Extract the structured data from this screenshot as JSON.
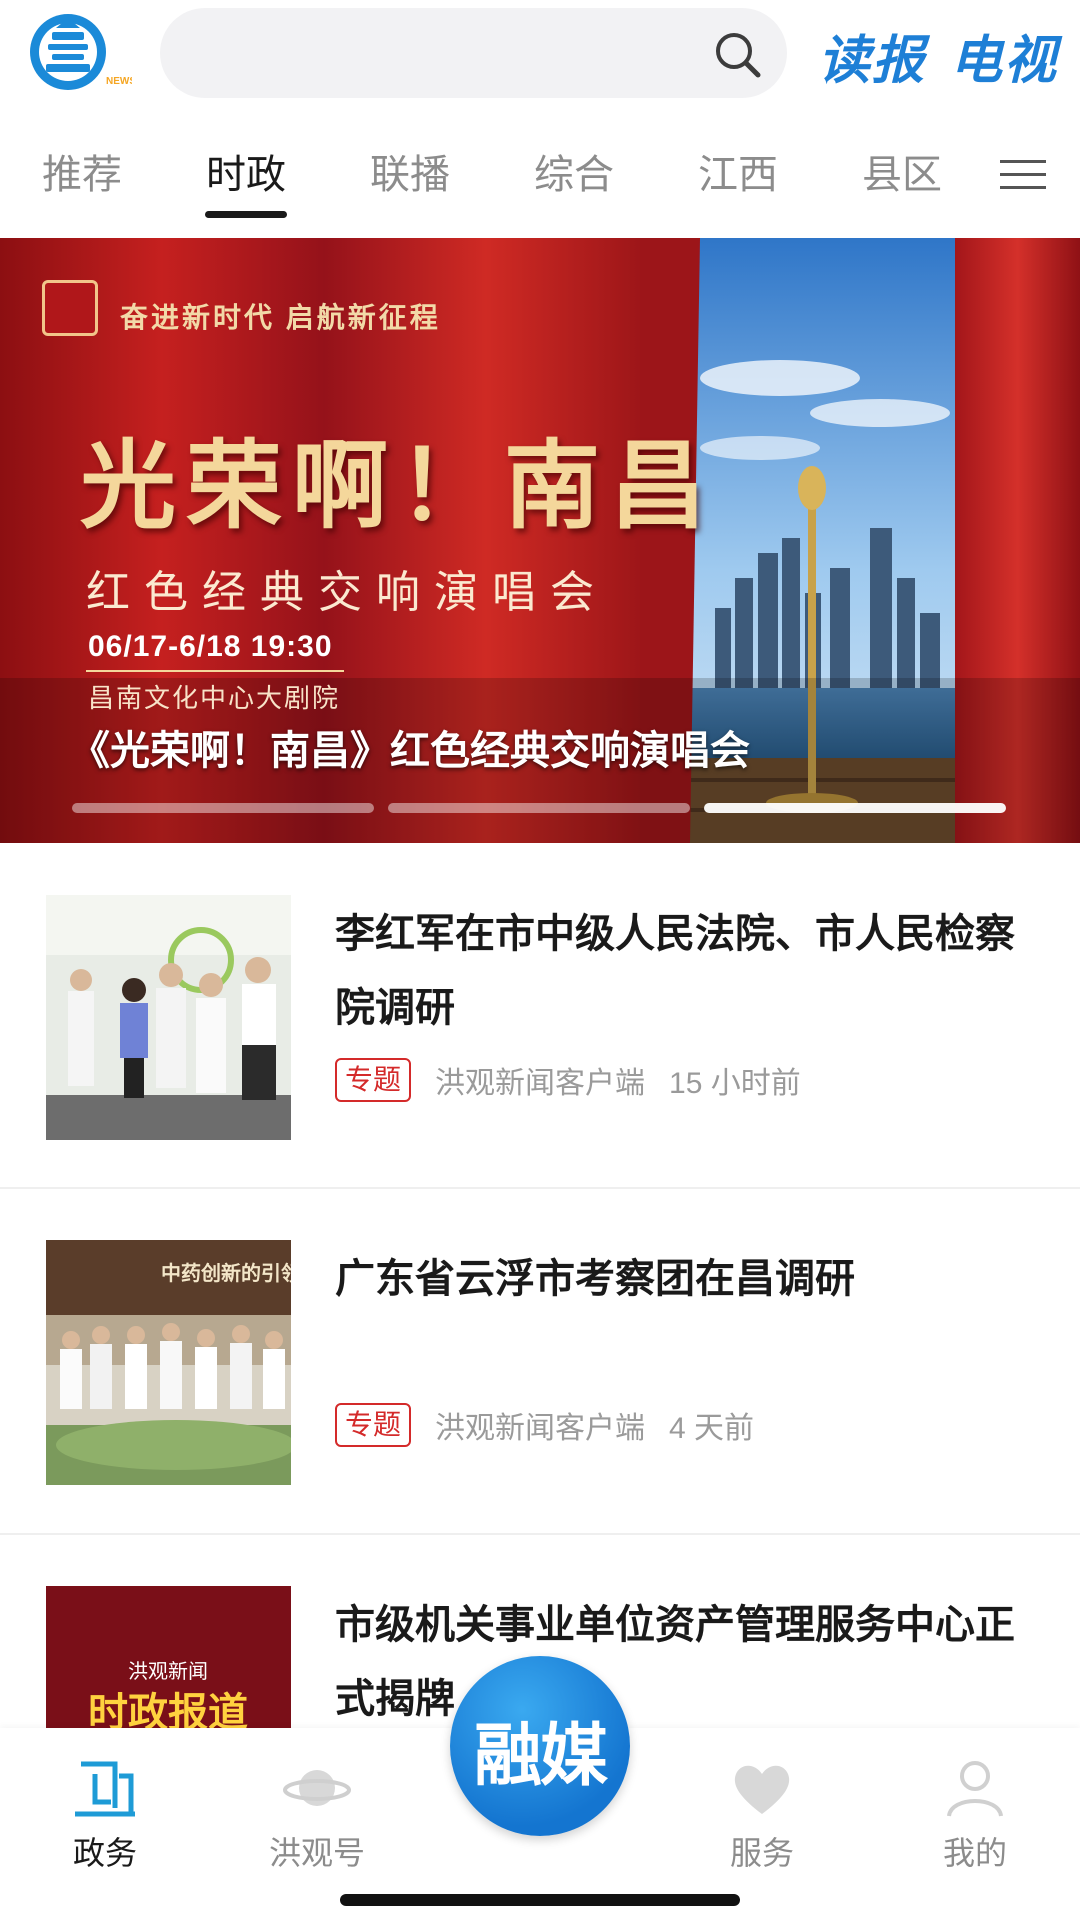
{
  "topbar": {
    "logo": "hongguan-news-logo",
    "search_placeholder": "",
    "read_label": "读报",
    "tv_label": "电视"
  },
  "tabs": [
    {
      "label": "推荐",
      "active": false
    },
    {
      "label": "时政",
      "active": true
    },
    {
      "label": "联播",
      "active": false
    },
    {
      "label": "综合",
      "active": false
    },
    {
      "label": "江西",
      "active": false
    },
    {
      "label": "县区",
      "active": false
    }
  ],
  "banner": {
    "slogan": "奋进新时代 启航新征程",
    "big_title": "光荣啊！南昌",
    "sub_title": "红色经典交响演唱会",
    "date": "06/17-6/18  19:30",
    "venue": "昌南文化中心大剧院",
    "caption": "《光荣啊！南昌》红色经典交响演唱会",
    "slide_count": 3,
    "active_slide": 3
  },
  "news": [
    {
      "title": "李红军在市中级人民法院、市人民检察院调研",
      "tag": "专题",
      "source": "洪观新闻客户端",
      "time": "15 小时前"
    },
    {
      "title": "广东省云浮市考察团在昌调研",
      "tag": "专题",
      "source": "洪观新闻客户端",
      "time": "4 天前",
      "thumb_text": "中药创新的引领"
    },
    {
      "title": "市级机关事业单位资产管理服务中心正式揭牌",
      "thumb_brand": "洪观新闻",
      "thumb_text": "时政报道"
    }
  ],
  "bottomnav": {
    "items": [
      {
        "label": "政务",
        "icon": "gov-icon",
        "active": true
      },
      {
        "label": "洪观号",
        "icon": "planet-icon",
        "active": false
      },
      {
        "label": "服务",
        "icon": "heart-icon",
        "active": false
      },
      {
        "label": "我的",
        "icon": "user-icon",
        "active": false
      }
    ],
    "center_label": "融媒"
  },
  "colors": {
    "accent_blue": "#1e7fd6",
    "accent_orange": "#f5a623",
    "tag_red": "#d42a2a",
    "muted": "#9a9a9a"
  }
}
